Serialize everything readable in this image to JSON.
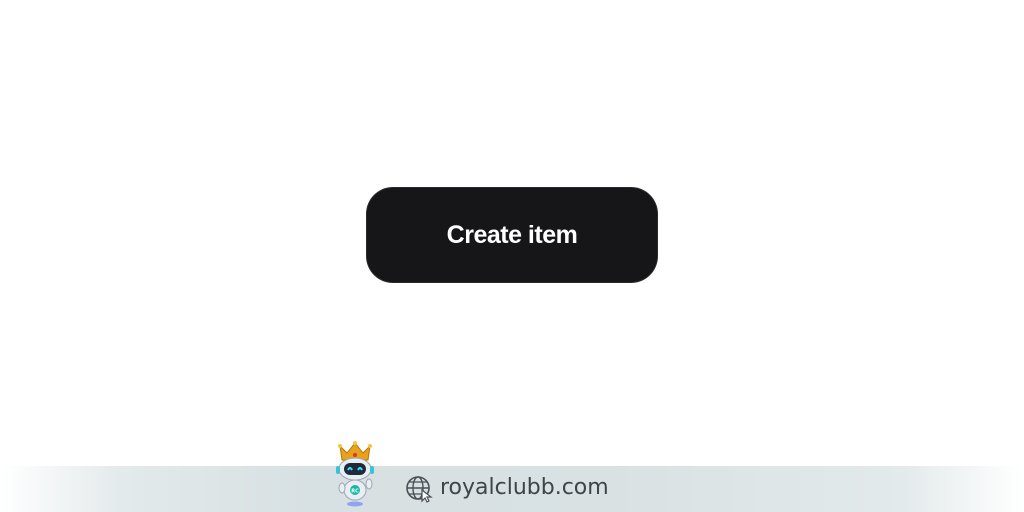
{
  "main": {
    "create_button_label": "Create item"
  },
  "watermark": {
    "text": "royalclubb.com",
    "mascot_icon": "robot-with-crown",
    "mascot_badge_text": "RC",
    "globe_icon": "globe-cursor-icon"
  },
  "colors": {
    "button_bg": "#161618",
    "button_text": "#ffffff",
    "page_bg": "#ffffff",
    "watermark_bar": "#d9e1e3",
    "watermark_text": "#3f4448"
  }
}
